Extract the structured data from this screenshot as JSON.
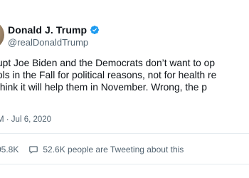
{
  "author": {
    "display_name": "Donald J. Trump",
    "handle": "@realDonaldTrump",
    "verified_icon": "verified-badge",
    "verified_color": "#1d9bf0"
  },
  "tweet": {
    "lines": [
      "upt Joe Biden and the Democrats don’t want to op",
      "ols in the Fall for political reasons, not for health re",
      "think it will help them in November. Wrong, the p",
      "!"
    ],
    "timestamp": "M · Jul 6, 2020"
  },
  "stats": {
    "likes": "05.8K",
    "tweeting": "52.6K people are Tweeting about this",
    "comment_icon": "comment-bubble-icon"
  },
  "colors": {
    "text": "#0f1419",
    "secondary": "#536471",
    "divider": "#e6ecf0"
  }
}
